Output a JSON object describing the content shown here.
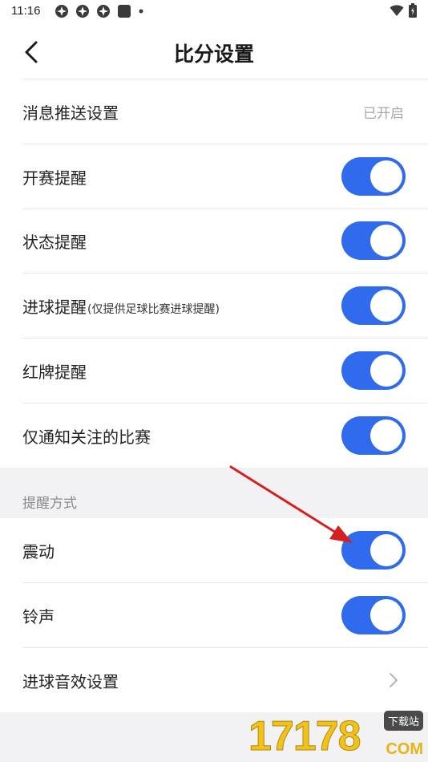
{
  "status_bar": {
    "time": "11:16",
    "notification_icons": [
      "app-icon",
      "app-icon",
      "app-icon",
      "square-icon",
      "dot-icon"
    ],
    "right_icons": [
      "wifi-icon",
      "battery-icon"
    ]
  },
  "header": {
    "title": "比分设置",
    "back_icon": "chevron-left-icon"
  },
  "settings": {
    "push": {
      "label": "消息推送设置",
      "value": "已开启"
    },
    "match_start": {
      "label": "开赛提醒",
      "on": true
    },
    "status": {
      "label": "状态提醒",
      "on": true
    },
    "goal": {
      "label": "进球提醒",
      "note": "(仅提供足球比赛进球提醒)",
      "on": true
    },
    "red_card": {
      "label": "红牌提醒",
      "on": true
    },
    "followed_only": {
      "label": "仅通知关注的比赛",
      "on": true
    }
  },
  "reminder_mode": {
    "group_label": "提醒方式",
    "vibrate": {
      "label": "震动",
      "on": true
    },
    "ringtone": {
      "label": "铃声",
      "on": true
    },
    "goal_sound": {
      "label": "进球音效设置",
      "icon": "chevron-right-icon"
    }
  },
  "watermark": {
    "digits": "17178",
    "badge": "下载站",
    "domain": "COM"
  },
  "colors": {
    "toggle_on": "#2f6bec",
    "annotation_arrow": "#d61f1f",
    "group_bg": "#f2f2f4"
  }
}
